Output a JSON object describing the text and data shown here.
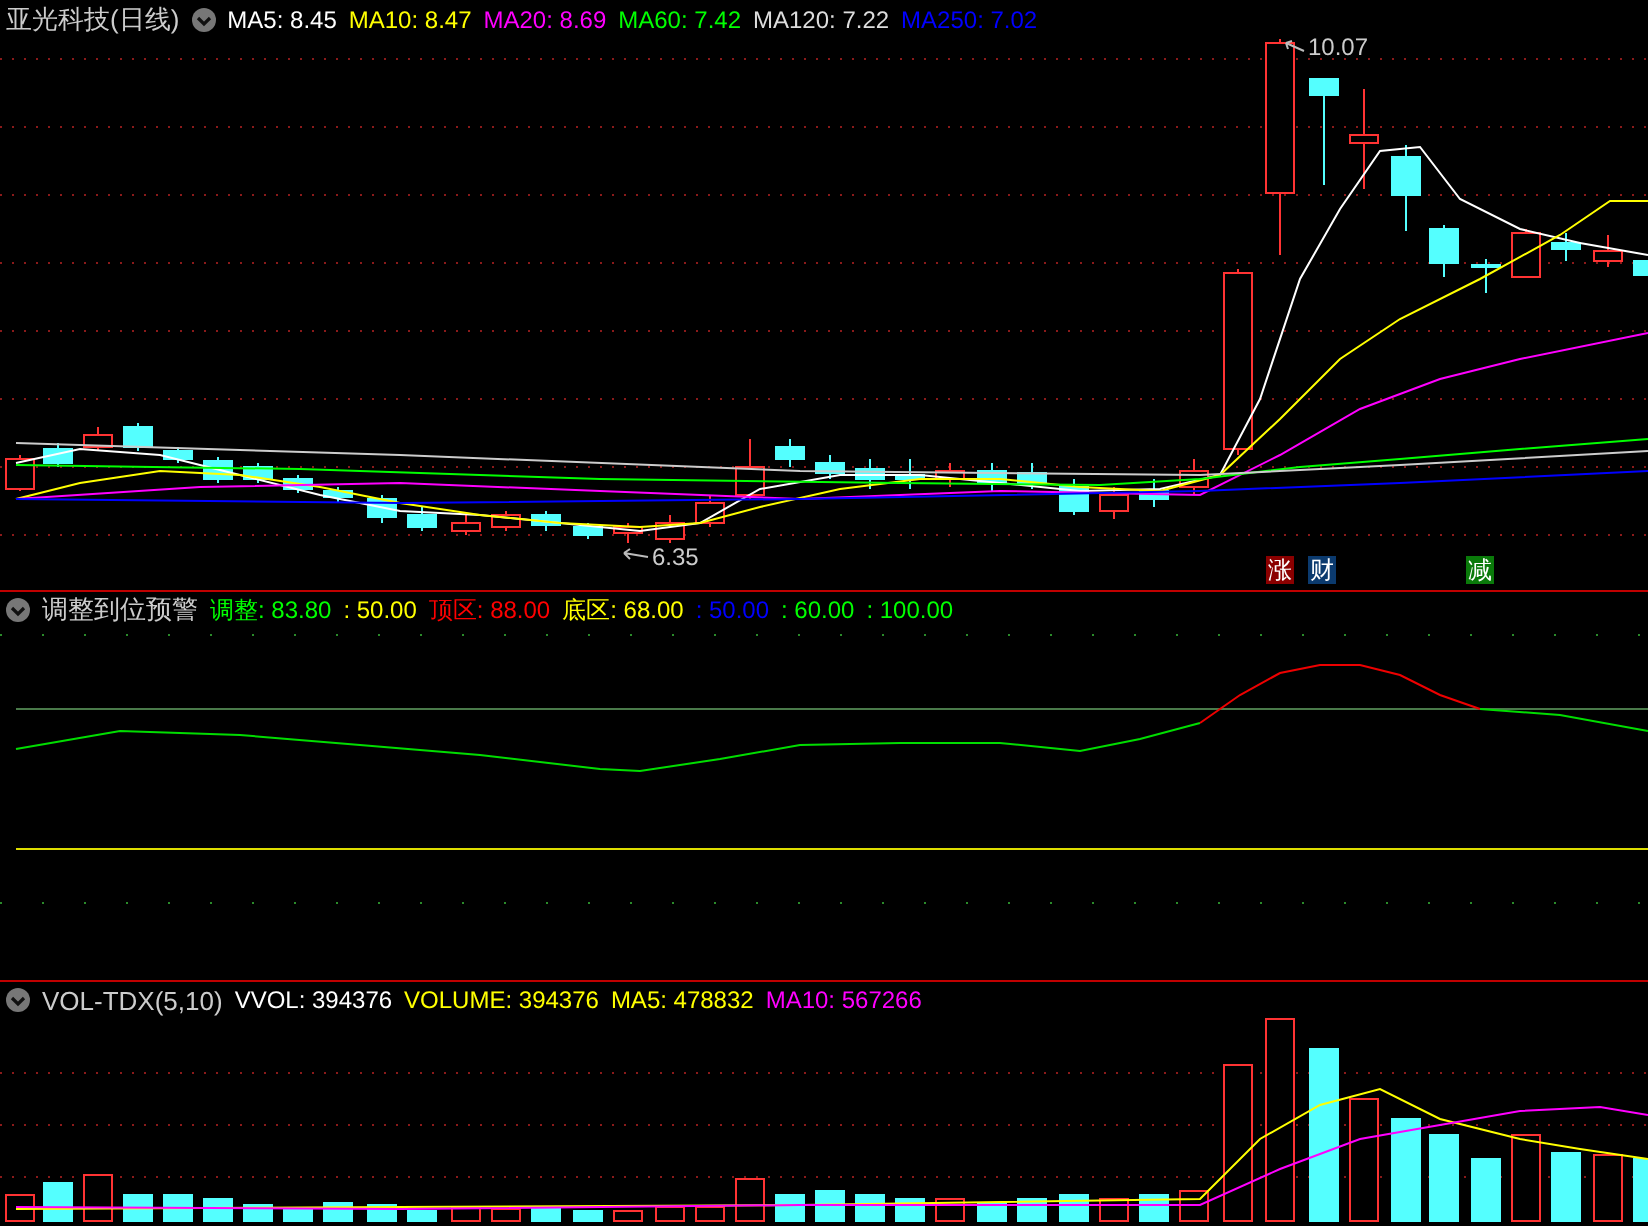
{
  "main_panel": {
    "title": "亚光科技(日线)",
    "indicators": [
      {
        "label": "MA5: 8.45",
        "color": "#ffffff"
      },
      {
        "label": "MA10: 8.47",
        "color": "#ffff00"
      },
      {
        "label": "MA20: 8.69",
        "color": "#ff00ff"
      },
      {
        "label": "MA60: 7.42",
        "color": "#00ff00"
      },
      {
        "label": "MA120: 7.22",
        "color": "#dddddd"
      },
      {
        "label": "MA250: 7.02",
        "color": "#0000ff"
      }
    ],
    "high_label": "10.07",
    "low_label": "6.35",
    "badges": [
      {
        "text": "涨",
        "color": "#8b0000"
      },
      {
        "text": "财",
        "color": "#0b3a6e"
      },
      {
        "text": "减",
        "color": "#0a7a0a"
      }
    ]
  },
  "signal_panel": {
    "title": "调整到位预警",
    "indicators": [
      {
        "label": "调整: 83.80",
        "color": "#00ff00"
      },
      {
        "label": ": 50.00",
        "color": "#ffff00"
      },
      {
        "label": "顶区: 88.00",
        "color": "#ff0000"
      },
      {
        "label": "底区: 68.00",
        "color": "#ffff00"
      },
      {
        "label": ": 50.00",
        "color": "#0000ff"
      },
      {
        "label": ": 60.00",
        "color": "#00ff00"
      },
      {
        "label": ": 100.00",
        "color": "#00ff00"
      }
    ]
  },
  "volume_panel": {
    "title": "VOL-TDX(5,10)",
    "indicators": [
      {
        "label": "VVOL: 394376",
        "color": "#ffffff"
      },
      {
        "label": "VOLUME: 394376",
        "color": "#ffff00"
      },
      {
        "label": "MA5: 478832",
        "color": "#ffff00"
      },
      {
        "label": "MA10: 567266",
        "color": "#ff00ff"
      }
    ]
  }
}
